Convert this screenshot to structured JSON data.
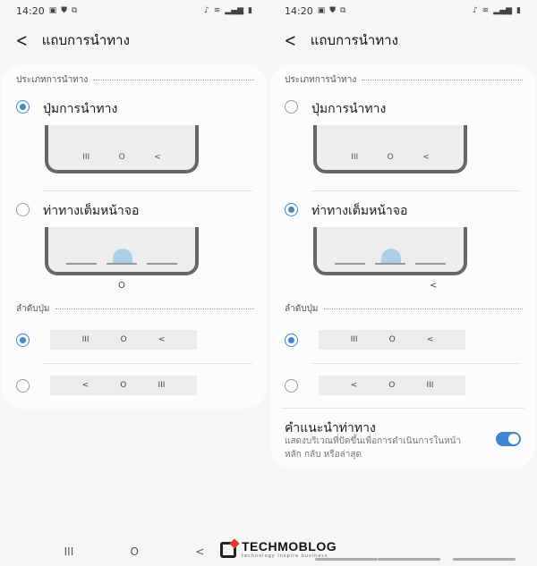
{
  "status": {
    "time": "14:20"
  },
  "appbar": {
    "title": "แถบการนำทาง"
  },
  "nav_type": {
    "header": "ประเภทการนำทาง",
    "options": [
      {
        "label": "ปุ่มการนำทาง"
      },
      {
        "label": "ท่าทางเต็มหน้าจอ"
      }
    ]
  },
  "button_order": {
    "header": "ลำดับปุ่ม"
  },
  "glyphs": {
    "recents": "III",
    "home": "O",
    "back": "<"
  },
  "screens": [
    {
      "selected_nav_type": "ปุ่มการนำทาง",
      "selected_order_index": 0,
      "gesture_hint_visible": false
    },
    {
      "selected_nav_type": "ท่าทางเต็มหน้าจอ",
      "selected_order_index": 0,
      "gesture_hint_visible": true
    }
  ],
  "gesture_hints": {
    "title": "คำแนะนำท่าทาง",
    "description": "แสดงบริเวณที่ปัดขึ้นเพื่อการดำเนินการในหน้าหลัก กลับ หรือล่าสุด",
    "enabled": true
  },
  "watermark": {
    "brand": "TECHMOBLOG",
    "tagline": "technology inspire business"
  },
  "colors": {
    "accent": "#3e86d6",
    "background": "#f6f6f6",
    "card": "#fcfcfc"
  }
}
